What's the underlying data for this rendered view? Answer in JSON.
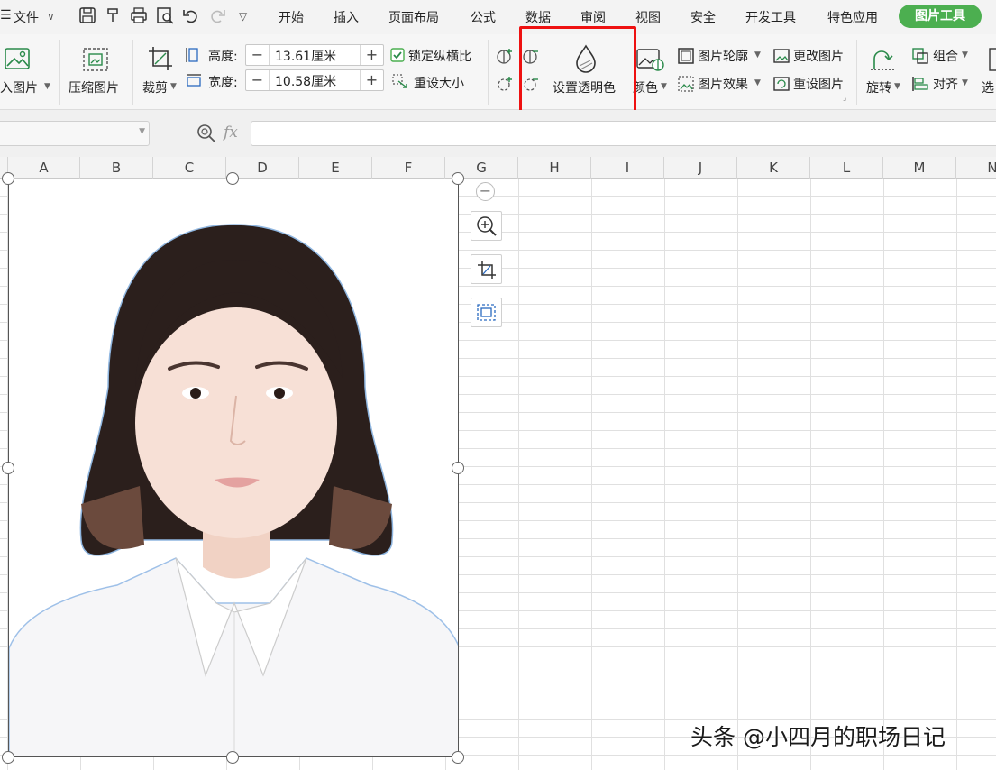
{
  "menu": {
    "file": "文件",
    "tabs": [
      "开始",
      "插入",
      "页面布局",
      "公式",
      "数据",
      "审阅",
      "视图",
      "安全",
      "开发工具",
      "特色应用"
    ],
    "active_tab": "图片工具"
  },
  "ribbon": {
    "insert_picture": "入图片",
    "compress_picture": "压缩图片",
    "crop": "裁剪",
    "height_label": "高度:",
    "height_value": "13.61厘米",
    "width_label": "宽度:",
    "width_value": "10.58厘米",
    "lock_ratio": "锁定纵横比",
    "reset_size": "重设大小",
    "set_transparent": "设置透明色",
    "color": "颜色",
    "picture_outline": "图片轮廓",
    "change_picture": "更改图片",
    "picture_effects": "图片效果",
    "reset_picture": "重设图片",
    "rotate": "旋转",
    "group": "组合",
    "align": "对齐",
    "select": "选"
  },
  "formula_bar": {
    "fx": "fx"
  },
  "columns": [
    "A",
    "B",
    "C",
    "D",
    "E",
    "F",
    "G",
    "H",
    "I",
    "J",
    "K",
    "L",
    "M",
    "N"
  ],
  "watermark": "头条 @小四月的职场日记",
  "colors": {
    "accent_green": "#4caf50",
    "highlight_red": "#ee1111"
  }
}
